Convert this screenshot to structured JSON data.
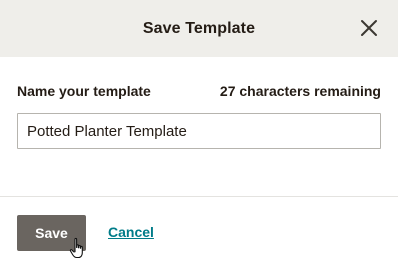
{
  "dialog": {
    "title": "Save Template",
    "close_icon": "close-icon"
  },
  "form": {
    "label": "Name your template",
    "remaining_count": 27,
    "remaining_text": "27 characters remaining",
    "input_value": "Potted Planter Template"
  },
  "actions": {
    "save_label": "Save",
    "cancel_label": "Cancel"
  },
  "cursor": "hand-pointer-icon",
  "colors": {
    "header_bg": "#efeeea",
    "primary_button": "#6a6560",
    "link": "#007c89",
    "text": "#241c15"
  }
}
